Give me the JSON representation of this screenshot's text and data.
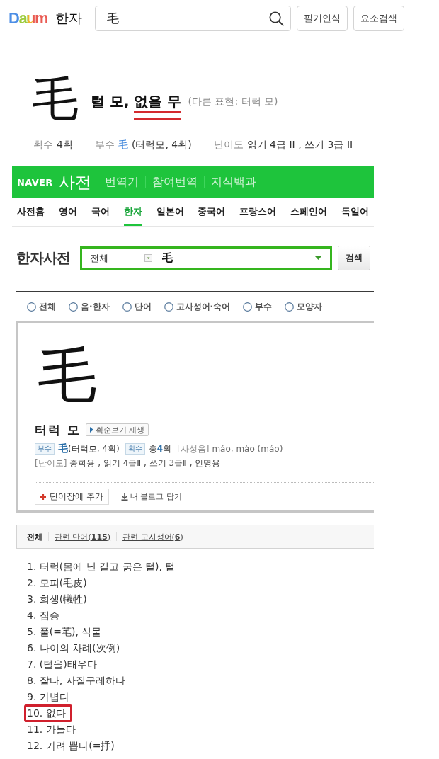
{
  "header": {
    "logo": "Daum",
    "section": "한자",
    "search": {
      "value": "毛"
    },
    "buttons": [
      "필기인식",
      "요소검색"
    ]
  },
  "entry": {
    "character": "毛",
    "readings": [
      {
        "text": "털 모,",
        "marked": false
      },
      {
        "text": "없을 무",
        "marked": true
      }
    ],
    "alt_expression": "(다른 표현: 터럭 모)",
    "meta": [
      {
        "label": "획수",
        "value": "4획"
      },
      {
        "label": "부수",
        "accent": "毛",
        "value": "(터럭모, 4획)"
      },
      {
        "label": "난이도",
        "value": "읽기 4급 II , 쓰기 3급 II"
      }
    ]
  },
  "naver": {
    "logo": "NAVER",
    "title": "사전",
    "links": [
      "번역기",
      "참여번역",
      "지식백과"
    ],
    "tabs": [
      {
        "label": "사전홈",
        "selected": false
      },
      {
        "label": "영어",
        "selected": false
      },
      {
        "label": "국어",
        "selected": false
      },
      {
        "label": "한자",
        "selected": true
      },
      {
        "label": "일본어",
        "selected": false
      },
      {
        "label": "중국어",
        "selected": false
      },
      {
        "label": "프랑스어",
        "selected": false
      },
      {
        "label": "스페인어",
        "selected": false
      },
      {
        "label": "독일어",
        "selected": false
      }
    ],
    "dictionary_title": "한자사전",
    "search": {
      "scope": "전체",
      "value": "毛",
      "button": "검색"
    },
    "filters": [
      {
        "label": "전체",
        "selected": false
      },
      {
        "label": "음·한자",
        "selected": false
      },
      {
        "label": "단어",
        "selected": false
      },
      {
        "label": "고사성어·숙어",
        "selected": false
      },
      {
        "label": "부수",
        "selected": false
      },
      {
        "label": "모양자",
        "selected": false
      }
    ],
    "card": {
      "character": "毛",
      "reading": "터럭 모",
      "stroke_button": "획순보기 재생",
      "radical_badge": "부수",
      "radical": "毛",
      "radical_detail": "(터럭모, 4획)",
      "strokes_badge": "획수",
      "strokes": "총**4**획",
      "pinyin_label": "[사성음]",
      "pinyin": "máo, mào (máo)",
      "level_label": "[난이도]",
      "level": "중학용 , 읽기 4급Ⅱ , 쓰기 3급Ⅱ , 인명용",
      "actions": [
        {
          "kind": "add",
          "label": "단어장에 추가"
        },
        {
          "kind": "save",
          "label": "내 블로그 담기"
        }
      ]
    },
    "result_tabs": [
      {
        "label": "전체",
        "selected": true
      },
      {
        "label": "관련 단어(**115**)",
        "selected": false
      },
      {
        "label": "관련 고사성어(**6**)",
        "selected": false
      }
    ],
    "meanings": [
      {
        "text": "1. 터럭(몸에 난 길고 굵은 털), 털",
        "marked": false
      },
      {
        "text": "2. 모피(毛皮)",
        "marked": false
      },
      {
        "text": "3. 희생(犧牲)",
        "marked": false
      },
      {
        "text": "4. 짐승",
        "marked": false
      },
      {
        "text": "5. 풀(=芼), 식물",
        "marked": false
      },
      {
        "text": "6. 나이의 차례(次例)",
        "marked": false
      },
      {
        "text": "7. (털을)태우다",
        "marked": false
      },
      {
        "text": "8. 잘다, 자질구레하다",
        "marked": false
      },
      {
        "text": "9. 가볍다",
        "marked": false
      },
      {
        "text": "10. 없다",
        "marked": true
      },
      {
        "text": "11. 가늘다",
        "marked": false
      },
      {
        "text": "12. 가려 뽑다(=抙)",
        "marked": false
      }
    ]
  }
}
